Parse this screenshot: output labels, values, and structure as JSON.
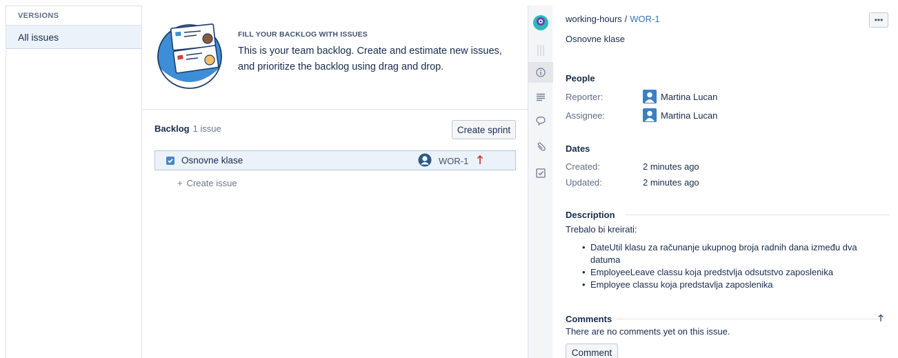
{
  "versions": {
    "header": "VERSIONS",
    "items": [
      {
        "label": "All issues"
      }
    ]
  },
  "banner": {
    "eyebrow": "FILL YOUR BACKLOG WITH ISSUES",
    "body": "This is your team backlog. Create and estimate new issues, and prioritize the backlog using drag and drop."
  },
  "backlog": {
    "title": "Backlog",
    "count": "1 issue",
    "create_sprint_label": "Create sprint",
    "create_issue_label": "Create issue",
    "issues": [
      {
        "summary": "Osnovne klase",
        "key": "WOR-1",
        "priority_icon": "priority-high-arrow-icon",
        "type_icon": "checkbox-task-icon"
      }
    ]
  },
  "detail": {
    "project": "working-hours",
    "separator": "/",
    "issue_key": "WOR-1",
    "summary": "Osnovne klase",
    "more_label": "•••",
    "people": {
      "title": "People",
      "reporter_label": "Reporter:",
      "reporter": "Martina Lucan",
      "assignee_label": "Assignee:",
      "assignee": "Martina Lucan"
    },
    "dates": {
      "title": "Dates",
      "created_label": "Created:",
      "created": "2 minutes ago",
      "updated_label": "Updated:",
      "updated": "2 minutes ago"
    },
    "description": {
      "title": "Description",
      "intro": "Trebalo bi kreirati:",
      "bullets": [
        "DateUtil klasu za računanje ukupnog broja radnih dana između dva datuma",
        "EmployeeLeave classu koja predstvlja odsutstvo zaposlenika",
        "Employee classu koja predstavlja zaposlenika"
      ]
    },
    "comments": {
      "title": "Comments",
      "empty": "There are no comments yet on this issue.",
      "button_label": "Comment"
    }
  },
  "strip_icons": [
    "project-avatar-icon",
    "drag-handle-icon",
    "info-icon",
    "description-icon",
    "comment-icon",
    "attachment-icon",
    "subtask-icon"
  ],
  "colors": {
    "accent": "#3572b0",
    "selected_row": "#ebf2fa",
    "priority_red": "#d04437"
  }
}
